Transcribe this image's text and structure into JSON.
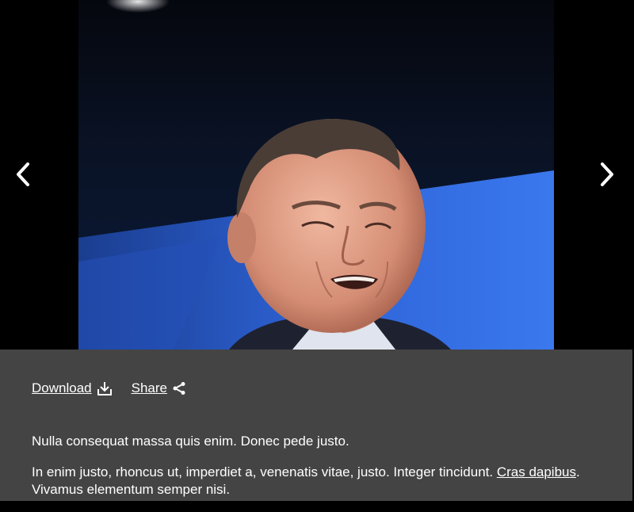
{
  "actions": {
    "download_label": "Download",
    "share_label": "Share"
  },
  "caption": {
    "line1": "Nulla consequat massa quis enim. Donec pede justo.",
    "line2_start": "In enim justo, rhoncus ut, imperdiet a, venenatis vitae, justo. Integer tincidunt.",
    "line2_link": "Cras dapibus",
    "line2_end": ". Vivamus elementum semper nisi."
  },
  "icons": {
    "prev": "chevron-left-icon",
    "next": "chevron-right-icon",
    "download": "download-icon",
    "share": "share-icon"
  },
  "colors": {
    "panel_bg": "#444444",
    "viewer_bg": "#000000",
    "text": "#ffffff"
  }
}
